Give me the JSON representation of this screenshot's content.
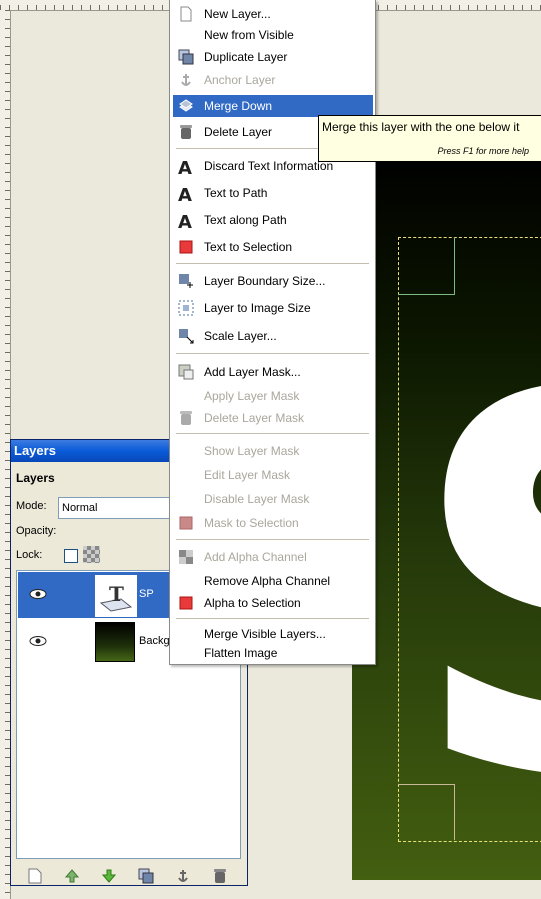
{
  "menu": {
    "items": [
      {
        "label": "New Layer...",
        "icon": "new-layer-icon",
        "enabled": true
      },
      {
        "label": "New from Visible",
        "icon": "",
        "enabled": true
      },
      {
        "label": "Duplicate Layer",
        "icon": "duplicate-layer-icon",
        "enabled": true
      },
      {
        "label": "Anchor Layer",
        "icon": "anchor-icon",
        "enabled": false
      },
      {
        "label": "Merge Down",
        "icon": "merge-down-icon",
        "enabled": true,
        "highlighted": true
      },
      {
        "label": "Delete Layer",
        "icon": "trash-icon",
        "enabled": true
      },
      {
        "label": "Discard Text Information",
        "icon": "text-tool-icon",
        "enabled": true
      },
      {
        "label": "Text to Path",
        "icon": "text-tool-icon",
        "enabled": true
      },
      {
        "label": "Text along Path",
        "icon": "text-tool-icon",
        "enabled": true
      },
      {
        "label": "Text to Selection",
        "icon": "red-selection-icon",
        "enabled": true
      },
      {
        "label": "Layer Boundary Size...",
        "icon": "boundary-size-icon",
        "enabled": true
      },
      {
        "label": "Layer to Image Size",
        "icon": "image-size-icon",
        "enabled": true
      },
      {
        "label": "Scale Layer...",
        "icon": "scale-icon",
        "enabled": true
      },
      {
        "label": "Add Layer Mask...",
        "icon": "layer-mask-icon",
        "enabled": true
      },
      {
        "label": "Apply Layer Mask",
        "icon": "",
        "enabled": false
      },
      {
        "label": "Delete Layer Mask",
        "icon": "trash-icon",
        "enabled": false
      },
      {
        "label": "Show Layer Mask",
        "icon": "",
        "enabled": false
      },
      {
        "label": "Edit Layer Mask",
        "icon": "",
        "enabled": false
      },
      {
        "label": "Disable Layer Mask",
        "icon": "",
        "enabled": false
      },
      {
        "label": "Mask to Selection",
        "icon": "red-selection-icon",
        "enabled": false
      },
      {
        "label": "Add Alpha Channel",
        "icon": "checker-icon",
        "enabled": false
      },
      {
        "label": "Remove Alpha Channel",
        "icon": "",
        "enabled": true
      },
      {
        "label": "Alpha to Selection",
        "icon": "red-selection-icon",
        "enabled": true
      },
      {
        "label": "Merge Visible Layers...",
        "icon": "",
        "enabled": true
      },
      {
        "label": "Flatten Image",
        "icon": "",
        "enabled": true
      }
    ]
  },
  "tooltip": {
    "text": "Merge this layer with the one below it",
    "help": "Press F1 for more help"
  },
  "layers_dialog": {
    "window_title": "Layers",
    "heading": "Layers",
    "mode_label": "Mode:",
    "mode_value": "Normal",
    "opacity_label": "Opacity:",
    "lock_label": "Lock:",
    "layers": [
      {
        "name": "SP",
        "selected": true,
        "visible": true
      },
      {
        "name": "Backgr",
        "selected": false,
        "visible": true
      }
    ]
  },
  "colors": {
    "menu_highlight": "#316ac5",
    "titlebar": "#0a5bd8",
    "tooltip_bg": "#ffffe1"
  }
}
